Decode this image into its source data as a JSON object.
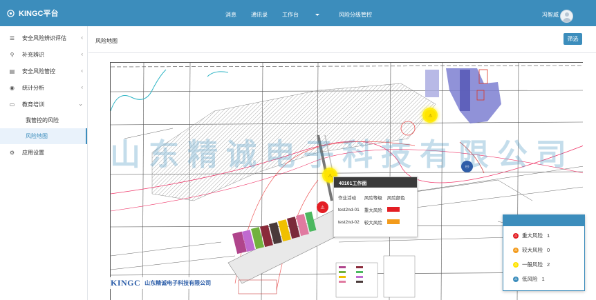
{
  "header": {
    "brand": "KINGC平台",
    "nav": [
      {
        "label": "消息"
      },
      {
        "label": "通讯录"
      },
      {
        "label": "工作台"
      },
      {
        "label": "风险分级管控"
      }
    ],
    "user_name": "冯智威"
  },
  "sidebar": {
    "items": [
      {
        "label": "安全风险辨识评估",
        "icon": "list-icon"
      },
      {
        "label": "补充辨识",
        "icon": "antenna-icon"
      },
      {
        "label": "安全风险管控",
        "icon": "folder-icon"
      },
      {
        "label": "统计分析",
        "icon": "eye-icon"
      },
      {
        "label": "教育培训",
        "icon": "monitor-icon"
      }
    ],
    "sub_items": [
      {
        "label": "我管控的风险"
      },
      {
        "label": "风险地图",
        "active": true
      }
    ],
    "settings": {
      "label": "应用设置",
      "icon": "gear-icon"
    }
  },
  "main": {
    "title": "风险地图",
    "filter_label": "筛选"
  },
  "map": {
    "watermark": "山东精诚电子科技有限公司",
    "logo_mark": "KINGC",
    "logo_company": "山东精诚电子科技有限公司"
  },
  "popup": {
    "title": "40101工作面",
    "columns": [
      "作业活动",
      "风险等级",
      "风险颜色"
    ],
    "rows": [
      {
        "activity": "test2nd-01",
        "level": "重大风险",
        "color": "#e31e24"
      },
      {
        "activity": "test2nd-02",
        "level": "较大风险",
        "color": "#f39b1c"
      }
    ]
  },
  "legend": {
    "items": [
      {
        "label": "重大风险",
        "count": "1",
        "color": "#e31e24"
      },
      {
        "label": "较大风险",
        "count": "0",
        "color": "#f39b1c"
      },
      {
        "label": "一般风险",
        "count": "2",
        "color": "#ffe400"
      },
      {
        "label": "低风险",
        "count": "1",
        "color": "#3c8dbc"
      }
    ]
  },
  "colors": {
    "primary": "#3c8dbc",
    "major": "#e31e24",
    "high": "#f39b1c",
    "general": "#ffe400",
    "low": "#3c8dbc"
  }
}
